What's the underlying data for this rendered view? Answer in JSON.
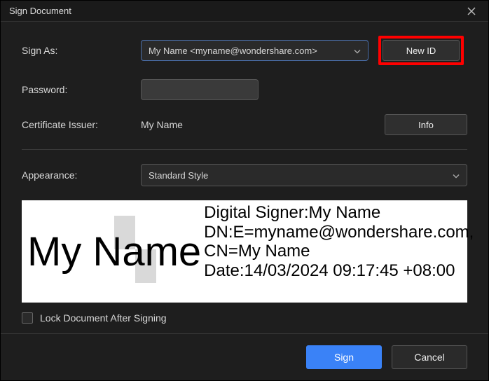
{
  "dialog": {
    "title": "Sign Document"
  },
  "labels": {
    "sign_as": "Sign As:",
    "password": "Password:",
    "cert_issuer": "Certificate Issuer:",
    "appearance": "Appearance:",
    "lock": "Lock Document After Signing"
  },
  "sign_as": {
    "selected": "My Name <myname@wondershare.com>"
  },
  "buttons": {
    "new_id": "New ID",
    "info": "Info",
    "sign": "Sign",
    "cancel": "Cancel"
  },
  "issuer": {
    "value": "My Name"
  },
  "appearance": {
    "selected": "Standard Style"
  },
  "preview": {
    "name": "My Name",
    "line1": "Digital Signer:My Name",
    "line2": "DN:E=myname@wondershare.com, CN=My Name",
    "line3": "Date:14/03/2024 09:17:45 +08:00"
  },
  "password": {
    "value": ""
  }
}
